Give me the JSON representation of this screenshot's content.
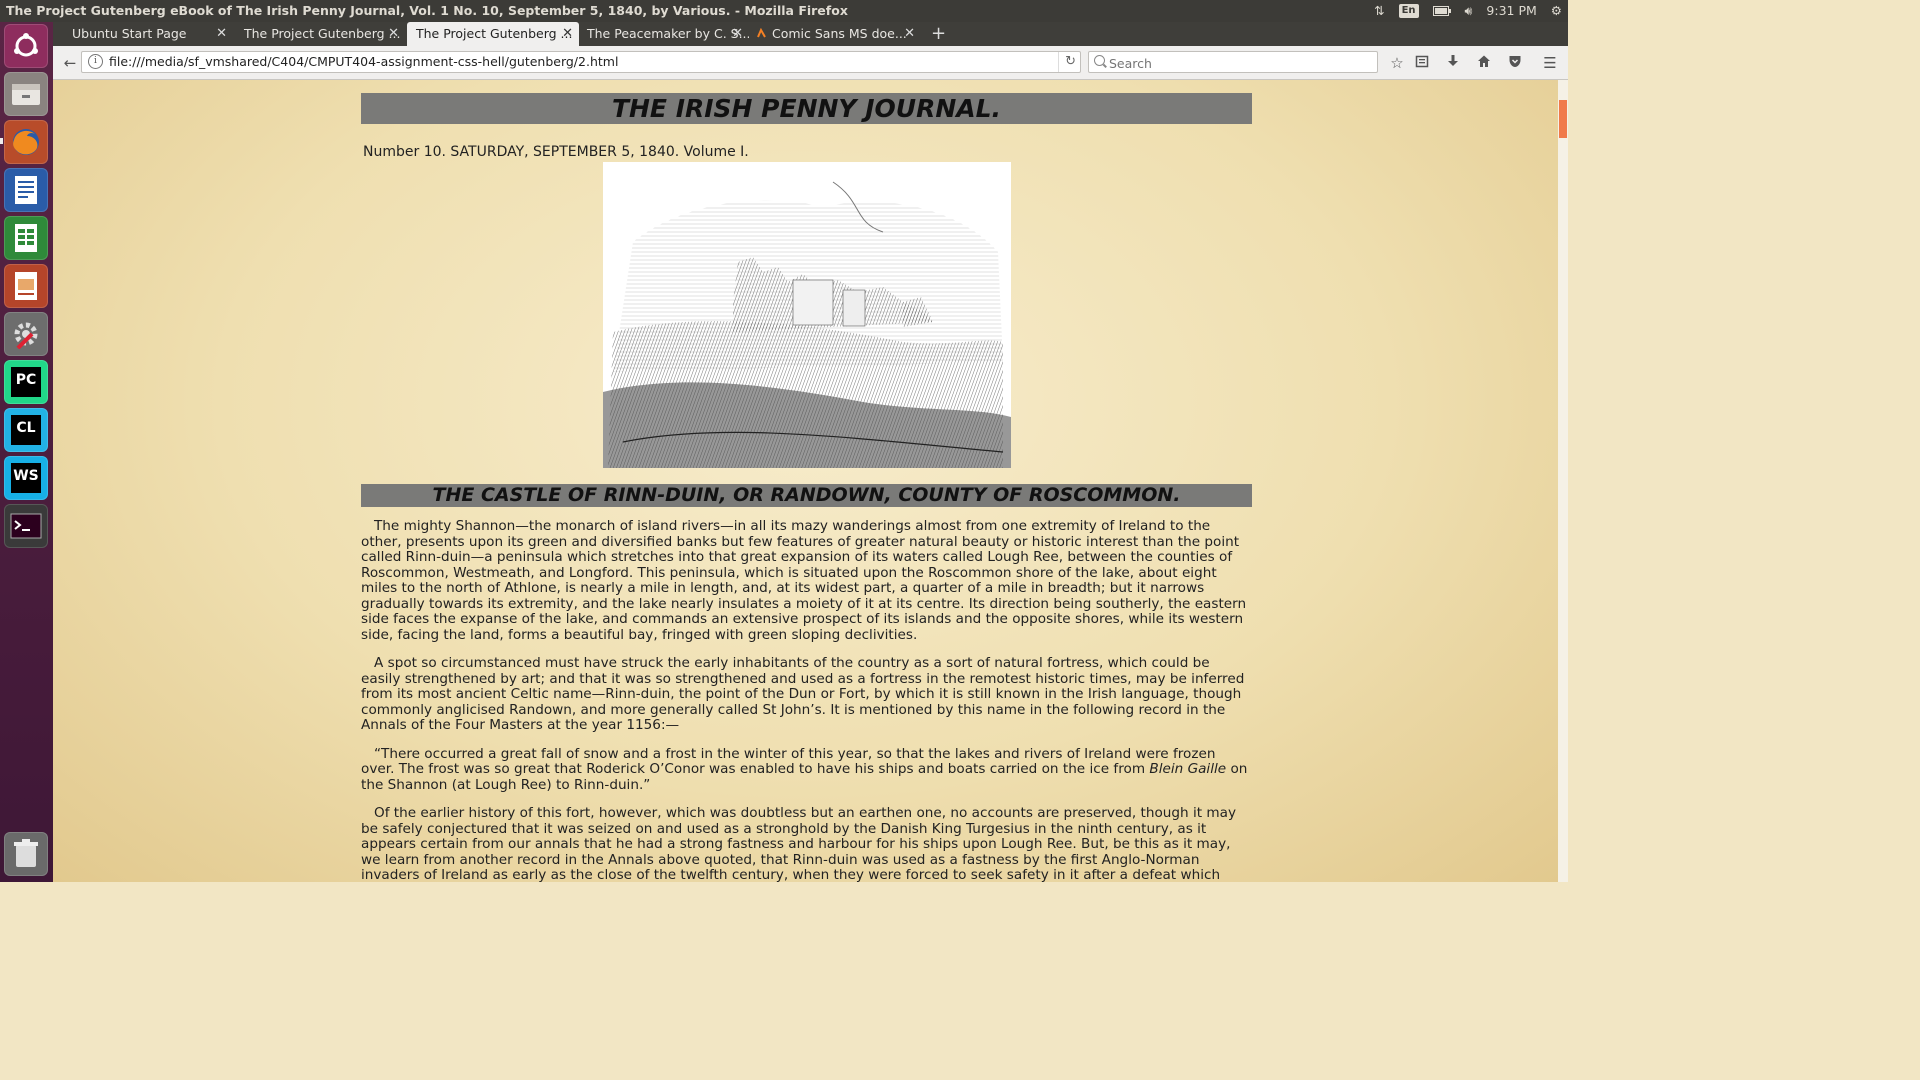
{
  "window": {
    "title": "The Project Gutenberg eBook of The Irish Penny Journal, Vol. 1 No. 10, September 5, 1840, by Various. - Mozilla Firefox"
  },
  "system": {
    "language": "En",
    "time": "9:31 PM"
  },
  "tabs": [
    {
      "label": "Ubuntu Start Page",
      "active": false
    },
    {
      "label": "The Project Gutenberg ...",
      "active": false
    },
    {
      "label": "The Project Gutenberg ...",
      "active": true
    },
    {
      "label": "The Peacemaker by C. S...",
      "active": false
    },
    {
      "label": "Comic Sans MS doe...",
      "active": false
    }
  ],
  "navbar": {
    "url": "file:///media/sf_vmshared/C404/CMPUT404-assignment-css-hell/gutenberg/2.html",
    "search_placeholder": "Search"
  },
  "launcher": {
    "items": [
      "Ubuntu dash",
      "Files",
      "Firefox",
      "LibreOffice Writer",
      "LibreOffice Calc",
      "LibreOffice Impress",
      "System Settings",
      "PyCharm",
      "CLion",
      "WebStorm",
      "Terminal",
      "Trash"
    ],
    "labels": {
      "pycharm": "PC",
      "clion": "CL",
      "webstorm": "WS"
    }
  },
  "article": {
    "journal_title": "THE IRISH PENNY JOURNAL.",
    "issue_line": "Number 10. SATURDAY, SEPTEMBER 5, 1840. Volume I.",
    "illustration": "castle-ruin-engraving",
    "heading": "THE CASTLE OF RINN-DUIN, OR RANDOWN, COUNTY OF ROSCOMMON.",
    "p1": "The mighty Shannon—the monarch of island rivers—in all its mazy wanderings almost from one extremity of Ireland to the other, presents upon its green and diversified banks but few features of greater natural beauty or historic interest than the point called Rinn-duin—a peninsula which stretches into that great expansion of its waters called Lough Ree, between the counties of Roscommon, Westmeath, and Longford. This peninsula, which is situated upon the Roscommon shore of the lake, about eight miles to the north of Athlone, is nearly a mile in length, and, at its widest part, a quarter of a mile in breadth; but it narrows gradually towards its extremity, and the lake nearly insulates a moiety of it at its centre. Its direction being southerly, the eastern side faces the expanse of the lake, and commands an extensive prospect of its islands and the opposite shores, while its western side, facing the land, forms a beautiful bay, fringed with green sloping declivities.",
    "p2": "A spot so circumstanced must have struck the early inhabitants of the country as a sort of natural fortress, which could be easily strengthened by art; and that it was so strengthened and used as a fortress in the remotest historic times, may be inferred from its most ancient Celtic name—Rinn-duin, the point of the Dun or Fort, by which it is still known in the Irish language, though commonly anglicised Randown, and more generally called St John’s. It is mentioned by this name in the following record in the Annals of the Four Masters at the year 1156:—",
    "p3_a": "“There occurred a great fall of snow and a frost in the winter of this year, so that the lakes and rivers of Ireland were frozen over. The frost was so great that Roderick O’Conor was enabled to have his ships and boats carried on the ice from ",
    "p3_em": "Blein Gaille",
    "p3_b": " on the Shannon (at Lough Ree) to Rinn-duin.”",
    "p4": "Of the earlier history of this fort, however, which was doubtless but an earthen one, no accounts are preserved, though it may be safely conjectured that it was seized on and used as a stronghold by the Danish King Turgesius in the ninth century, as it appears certain from our annals that he had a strong fastness and harbour for his ships upon Lough Ree. But, be this as it may, we learn from another record in the Annals above quoted, that Rinn-duin was used as a fastness by the first Anglo-Norman invaders of Ireland as early as the close of the twelfth century, when they were forced to seek safety in it after a defeat which they had sustained in a battle with Cathal"
  }
}
